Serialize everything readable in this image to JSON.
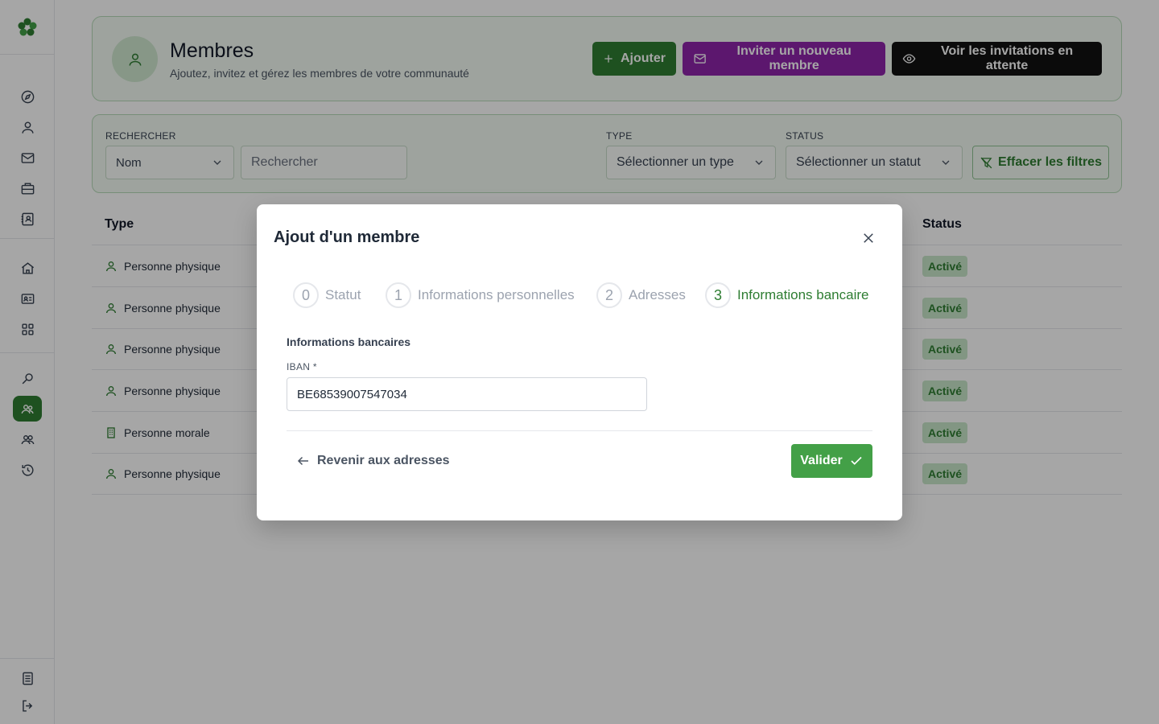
{
  "header": {
    "title": "Membres",
    "subtitle": "Ajoutez, invitez et gérez les membres de votre communauté",
    "add_label": "Ajouter",
    "invite_label": "Inviter un nouveau membre",
    "pending_label": "Voir les invitations en attente"
  },
  "filters": {
    "search_label": "RECHERCHER",
    "search_field_selected": "Nom",
    "search_placeholder": "Rechercher",
    "type_label": "TYPE",
    "type_placeholder": "Sélectionner un type",
    "status_label": "STATUS",
    "status_placeholder": "Sélectionner un statut",
    "clear_label": "Effacer les filtres"
  },
  "table": {
    "columns": [
      "Type",
      "Status"
    ],
    "rows": [
      {
        "type": "Personne physique",
        "type_icon": "user-icon",
        "status": "Activé"
      },
      {
        "type": "Personne physique",
        "type_icon": "user-icon",
        "status": "Activé"
      },
      {
        "type": "Personne physique",
        "type_icon": "user-icon",
        "status": "Activé"
      },
      {
        "type": "Personne physique",
        "type_icon": "user-icon",
        "status": "Activé"
      },
      {
        "type": "Personne morale",
        "type_icon": "building-icon",
        "status": "Activé"
      },
      {
        "type": "Personne physique",
        "type_icon": "user-icon",
        "status": "Activé"
      }
    ]
  },
  "modal": {
    "title": "Ajout d'un membre",
    "steps": [
      {
        "num": "0",
        "label": "Statut"
      },
      {
        "num": "1",
        "label": "Informations personnelles"
      },
      {
        "num": "2",
        "label": "Adresses"
      },
      {
        "num": "3",
        "label": "Informations bancaire"
      }
    ],
    "current_step": 3,
    "section_title": "Informations bancaires",
    "iban_label": "IBAN *",
    "iban_value": "BE68539007547034",
    "back_label": "Revenir aux adresses",
    "validate_label": "Valider"
  },
  "colors": {
    "primary": "#2e7d32",
    "invite": "#8e24aa",
    "dark": "#111111",
    "success_bg": "#c8e6c9"
  }
}
